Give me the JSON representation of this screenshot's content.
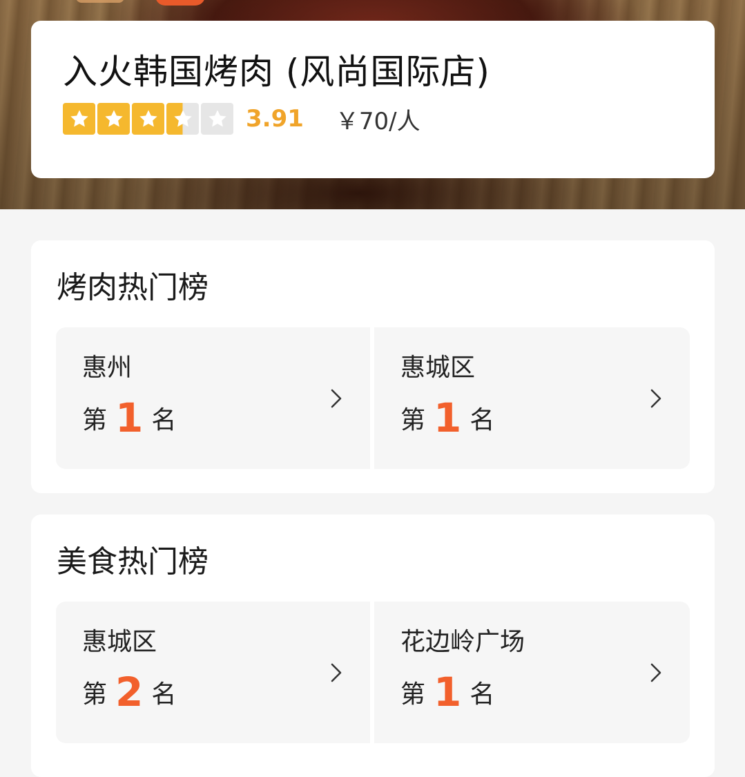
{
  "shop": {
    "name": "入火韩国烤肉 (风尚国际店)",
    "rating": {
      "score": "3.91",
      "stars_filled": 3.5,
      "stars_total": 5
    },
    "price": "￥70/人"
  },
  "colors": {
    "star": "#f5b82e",
    "score": "#f0a42a",
    "rank_number": "#f2602c"
  },
  "rank_sections": [
    {
      "title": "烤肉热门榜",
      "items": [
        {
          "area": "惠州",
          "prefix": "第",
          "rank": "1",
          "suffix": "名"
        },
        {
          "area": "惠城区",
          "prefix": "第",
          "rank": "1",
          "suffix": "名"
        }
      ]
    },
    {
      "title": "美食热门榜",
      "items": [
        {
          "area": "惠城区",
          "prefix": "第",
          "rank": "2",
          "suffix": "名"
        },
        {
          "area": "花边岭广场",
          "prefix": "第",
          "rank": "1",
          "suffix": "名"
        }
      ]
    }
  ],
  "icons": {
    "star": "star-icon",
    "chevron": "chevron-right-icon"
  }
}
